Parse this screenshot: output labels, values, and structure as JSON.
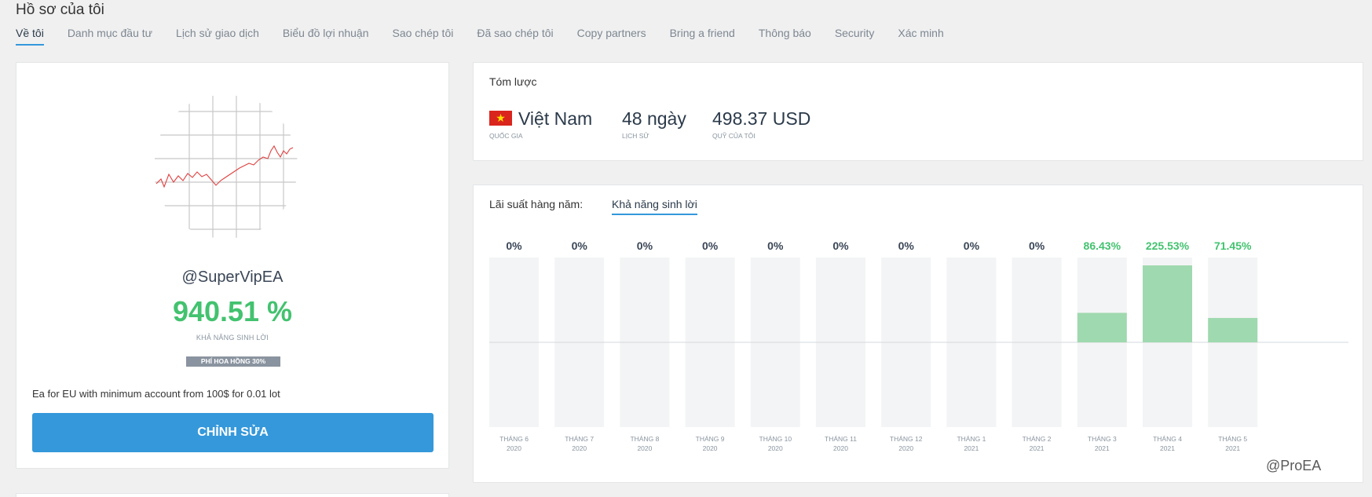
{
  "page": {
    "title": "Hồ sơ của tôi"
  },
  "tabs": [
    {
      "label": "Về tôi",
      "active": true
    },
    {
      "label": "Danh mục đầu tư",
      "active": false
    },
    {
      "label": "Lịch sử giao dịch",
      "active": false
    },
    {
      "label": "Biểu đồ lợi nhuận",
      "active": false
    },
    {
      "label": "Sao chép tôi",
      "active": false
    },
    {
      "label": "Đã sao chép tôi",
      "active": false
    },
    {
      "label": "Copy partners",
      "active": false
    },
    {
      "label": "Bring a friend",
      "active": false
    },
    {
      "label": "Thông báo",
      "active": false
    },
    {
      "label": "Security",
      "active": false
    },
    {
      "label": "Xác minh",
      "active": false
    }
  ],
  "profile": {
    "username": "@SuperVipEA",
    "profitability": "940.51 %",
    "profitability_label": "KHẢ NĂNG SINH LỜI",
    "commission_badge": "PHÍ HOA HỒNG 30%",
    "bio": "Ea for EU with minimum account from 100$ for 0.01 lot",
    "edit_button": "CHỈNH SỬA"
  },
  "summary": {
    "title": "Tóm lược",
    "country": "Việt Nam",
    "country_label": "QUỐC GIA",
    "history": "48 ngày",
    "history_label": "LỊCH SỬ",
    "funds": "498.37 USD",
    "funds_label": "QUỸ CỦA TÔI"
  },
  "chart_header": {
    "label": "Lãi suất hàng năm:",
    "tab": "Khả năng sinh lời"
  },
  "colors": {
    "accent": "#3498db",
    "positive": "#43c26f",
    "bar_positive": "#9fd9af",
    "bar_bg": "#f3f4f5"
  },
  "chart_data": {
    "type": "bar",
    "categories": [
      [
        "THÁNG 6",
        "2020"
      ],
      [
        "THÁNG 7",
        "2020"
      ],
      [
        "THÁNG 8",
        "2020"
      ],
      [
        "THÁNG 9",
        "2020"
      ],
      [
        "THÁNG 10",
        "2020"
      ],
      [
        "THÁNG 11",
        "2020"
      ],
      [
        "THÁNG 12",
        "2020"
      ],
      [
        "THÁNG 1",
        "2021"
      ],
      [
        "THÁNG 2",
        "2021"
      ],
      [
        "THÁNG 3",
        "2021"
      ],
      [
        "THÁNG 4",
        "2021"
      ],
      [
        "THÁNG 5",
        "2021"
      ]
    ],
    "values": [
      0,
      0,
      0,
      0,
      0,
      0,
      0,
      0,
      0,
      86.43,
      225.53,
      71.45
    ],
    "value_labels": [
      "0%",
      "0%",
      "0%",
      "0%",
      "0%",
      "0%",
      "0%",
      "0%",
      "0%",
      "86.43%",
      "225.53%",
      "71.45%"
    ],
    "ylim": [
      -225.53,
      225.53
    ],
    "grid": false
  },
  "watermark": "@ProEA"
}
